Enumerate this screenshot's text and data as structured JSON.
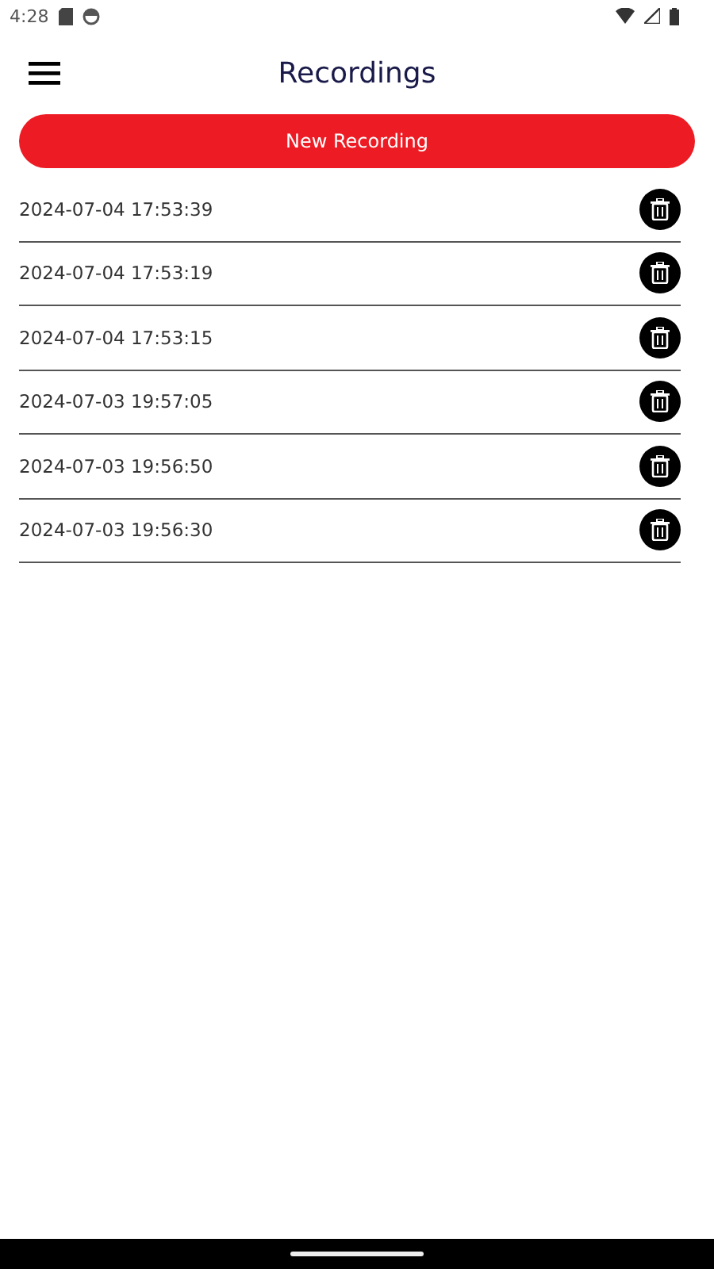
{
  "status_bar": {
    "time": "4:28"
  },
  "header": {
    "title": "Recordings"
  },
  "new_button": {
    "label": "New Recording"
  },
  "recordings": [
    {
      "label": "2024-07-04 17:53:39"
    },
    {
      "label": "2024-07-04 17:53:19"
    },
    {
      "label": "2024-07-04 17:53:15"
    },
    {
      "label": "2024-07-03 19:57:05"
    },
    {
      "label": "2024-07-03 19:56:50"
    },
    {
      "label": "2024-07-03 19:56:30"
    }
  ]
}
